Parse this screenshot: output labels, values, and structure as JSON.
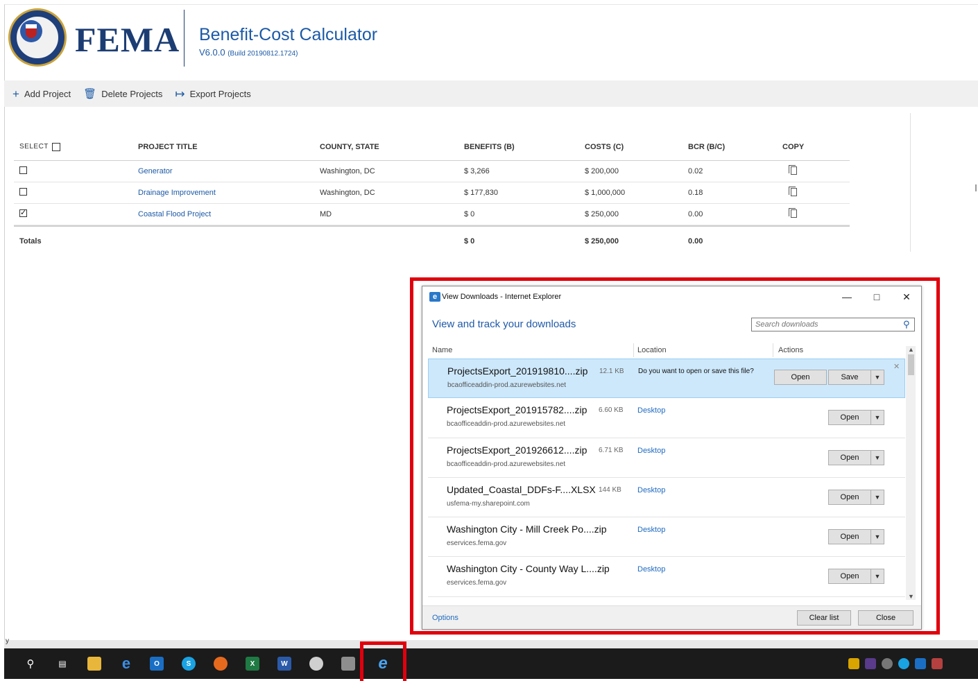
{
  "header": {
    "brand": "FEMA",
    "app_title": "Benefit-Cost Calculator",
    "version": "V6.0.0",
    "build": "(Build 20190812.1724)"
  },
  "toolbar": {
    "add_label": "Add Project",
    "delete_label": "Delete Projects",
    "export_label": "Export Projects"
  },
  "table": {
    "headers": {
      "select": "SELECT",
      "title": "PROJECT TITLE",
      "county": "COUNTY, STATE",
      "benefits": "BENEFITS (B)",
      "costs": "COSTS (C)",
      "bcr": "BCR (B/C)",
      "copy": "COPY"
    },
    "rows": [
      {
        "checked": false,
        "title": "Generator",
        "county": "Washington, DC",
        "benefits": "$ 3,266",
        "costs": "$ 200,000",
        "bcr": "0.02"
      },
      {
        "checked": false,
        "title": "Drainage Improvement",
        "county": "Washington, DC",
        "benefits": "$ 177,830",
        "costs": "$ 1,000,000",
        "bcr": "0.18"
      },
      {
        "checked": true,
        "title": "Coastal Flood Project",
        "county": "MD",
        "benefits": "$ 0",
        "costs": "$ 250,000",
        "bcr": "0.00"
      }
    ],
    "totals": {
      "label": "Totals",
      "benefits": "$ 0",
      "costs": "$ 250,000",
      "bcr": "0.00"
    }
  },
  "dialog": {
    "title": "View Downloads - Internet Explorer",
    "heading": "View and track your downloads",
    "search_placeholder": "Search downloads",
    "columns": {
      "name": "Name",
      "location": "Location",
      "actions": "Actions"
    },
    "items": [
      {
        "name": "ProjectsExport_201919810....zip",
        "size": "12.1 KB",
        "source": "bcaofficeaddin-prod.azurewebsites.net",
        "prompt": "Do you want to open or save this file?",
        "open": "Open",
        "save": "Save"
      },
      {
        "name": "ProjectsExport_201915782....zip",
        "size": "6.60 KB",
        "source": "bcaofficeaddin-prod.azurewebsites.net",
        "location": "Desktop",
        "open": "Open"
      },
      {
        "name": "ProjectsExport_201926612....zip",
        "size": "6.71 KB",
        "source": "bcaofficeaddin-prod.azurewebsites.net",
        "location": "Desktop",
        "open": "Open"
      },
      {
        "name": "Updated_Coastal_DDFs-F....XLSX",
        "size": "144 KB",
        "source": "usfema-my.sharepoint.com",
        "location": "Desktop",
        "open": "Open"
      },
      {
        "name": "Washington City - Mill Creek Po....zip",
        "size": "",
        "source": "eservices.fema.gov",
        "location": "Desktop",
        "open": "Open"
      },
      {
        "name": "Washington City - County Way L....zip",
        "size": "",
        "source": "eservices.fema.gov",
        "location": "Desktop",
        "open": "Open"
      }
    ],
    "options_label": "Options",
    "clear_label": "Clear list",
    "close_label": "Close"
  },
  "taskbar": {
    "y_text": "y",
    "icons": [
      "search-icon",
      "task-view-icon",
      "file-explorer-icon",
      "edge-icon",
      "outlook-icon",
      "skype-icon",
      "firefox-icon",
      "excel-icon",
      "word-icon",
      "paint-icon",
      "app-icon",
      "internet-explorer-icon"
    ]
  },
  "colors": {
    "fema_blue": "#1c3d73",
    "link_blue": "#1c5aa6",
    "highlight_red": "#e0000d",
    "selected_row": "#cde8fb"
  }
}
